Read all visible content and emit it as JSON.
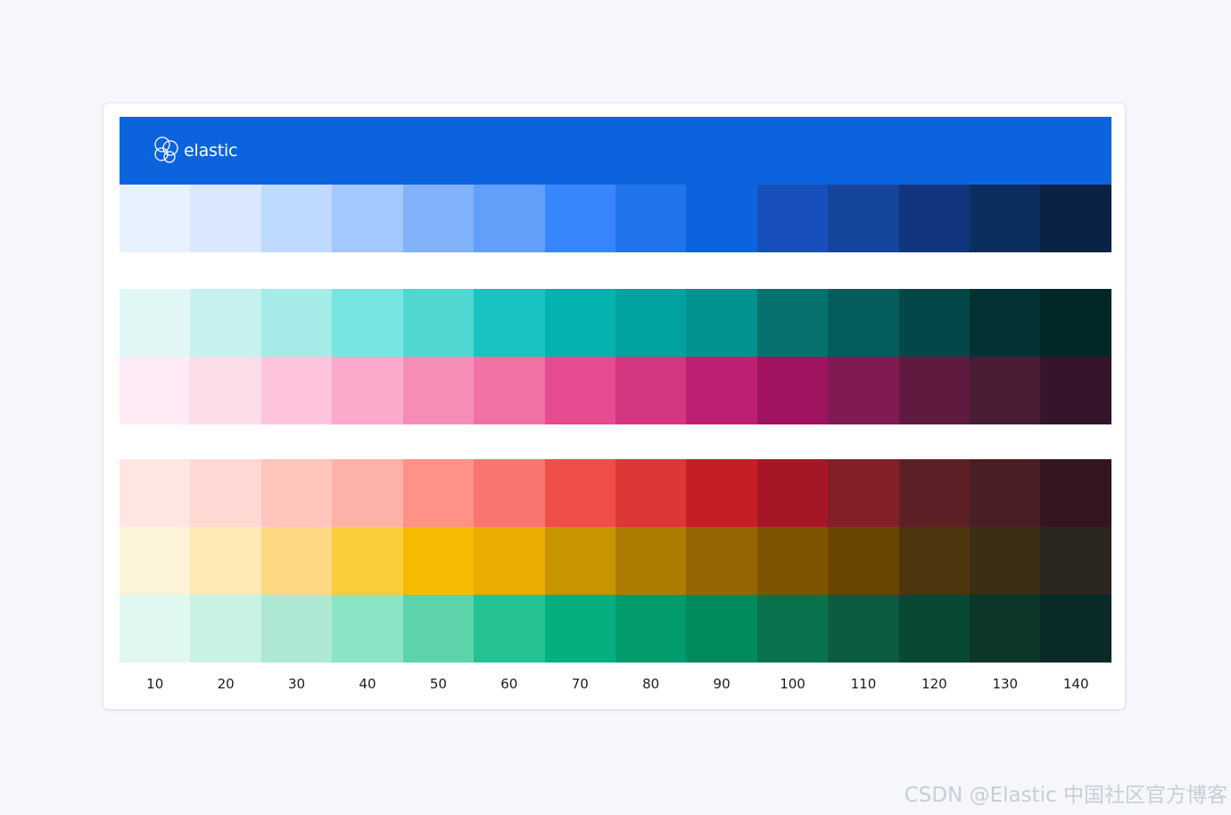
{
  "brand": {
    "name": "elastic",
    "color": "#0b64dd"
  },
  "scale_labels": [
    "10",
    "20",
    "30",
    "40",
    "50",
    "60",
    "70",
    "80",
    "90",
    "100",
    "110",
    "120",
    "130",
    "140"
  ],
  "palettes": [
    {
      "key": "blue",
      "colors": [
        "#e8f1ff",
        "#d9e8ff",
        "#c0d9ff",
        "#a3c7ff",
        "#82b2fa",
        "#629ffb",
        "#3886fe",
        "#2174ec",
        "#0b64dd",
        "#1750ba",
        "#15449c",
        "#123580",
        "#0c2e5e",
        "#0a2344"
      ]
    },
    {
      "key": "teal",
      "colors": [
        "#e0f7f5",
        "#c7f1ee",
        "#a5ece9",
        "#78e6e0",
        "#52d6d2",
        "#18c4c1",
        "#04b2ae",
        "#02a29e",
        "#00928f",
        "#05726d",
        "#055c5d",
        "#034849",
        "#033234",
        "#022729"
      ]
    },
    {
      "key": "pink",
      "colors": [
        "#ffebf5",
        "#fddcea",
        "#fdc4dc",
        "#fcaacb",
        "#f68db6",
        "#f071a4",
        "#e64a8f",
        "#d4377f",
        "#bf1f72",
        "#a0135f",
        "#811a51",
        "#5f1a40",
        "#491c34",
        "#35152b"
      ]
    },
    {
      "key": "red",
      "colors": [
        "#ffe6e3",
        "#fed9d4",
        "#fec5bd",
        "#feb1a7",
        "#ff9189",
        "#f87570",
        "#f04e4a",
        "#dd3737",
        "#c61e25",
        "#a71627",
        "#821f28",
        "#5e2027",
        "#4a1e25",
        "#351620"
      ]
    },
    {
      "key": "yellow",
      "colors": [
        "#fdf3d8",
        "#fde9b6",
        "#fcd883",
        "#fbcd3d",
        "#f6ba00",
        "#ebac00",
        "#c89400",
        "#ad7c00",
        "#946500",
        "#7d5400",
        "#6a4600",
        "#4d360e",
        "#3a2e14",
        "#2b2720"
      ]
    },
    {
      "key": "green",
      "colors": [
        "#e1f8f0",
        "#c8f2e1",
        "#aee8d2",
        "#8ae4c5",
        "#5dd3aa",
        "#24c292",
        "#07af7f",
        "#019b6c",
        "#008a5e",
        "#09724d",
        "#0b5a42",
        "#084834",
        "#0c3629",
        "#0a2a27"
      ]
    }
  ],
  "watermark": "CSDN @Elastic 中国社区官方博客"
}
